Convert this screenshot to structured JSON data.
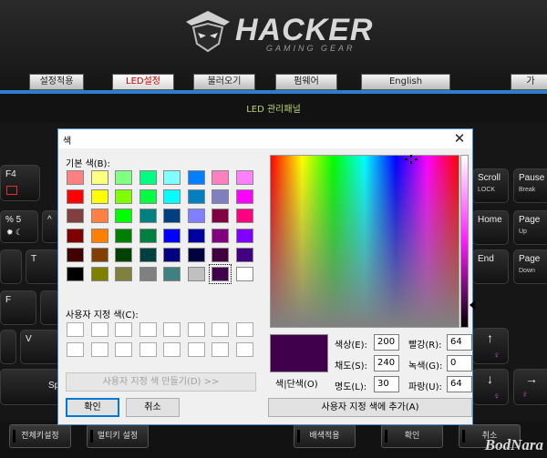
{
  "app": {
    "brand": "HACKER",
    "brand_sub": "GAMING GEAR",
    "nav_tabs": [
      {
        "label": "설정적용"
      },
      {
        "label": "LED설정"
      },
      {
        "label": "불러오기"
      },
      {
        "label": "펌웨어"
      },
      {
        "label": "English"
      },
      {
        "label": "가"
      }
    ],
    "sub_title": "LED 관리패널",
    "bottom_buttons": [
      "전체키설정",
      "멀티키 설정",
      "배색적용",
      "확인",
      "취소"
    ],
    "watermark": "BodNara"
  },
  "keyboard": {
    "keys": [
      {
        "main": "F4",
        "sub": ""
      },
      {
        "main": "% 5",
        "sub": ""
      },
      {
        "main": "^",
        "sub": ""
      },
      {
        "main": "T",
        "sub": ""
      },
      {
        "main": "F",
        "sub": ""
      },
      {
        "main": "V",
        "sub": ""
      },
      {
        "main": "Sp",
        "sub": ""
      },
      {
        "main": "Scroll",
        "sub": "LOCK"
      },
      {
        "main": "Pause",
        "sub": "Break"
      },
      {
        "main": "Home",
        "sub": ""
      },
      {
        "main": "Page",
        "sub": "Up"
      },
      {
        "main": "End",
        "sub": ""
      },
      {
        "main": "Page",
        "sub": "Down"
      },
      {
        "main": "↑",
        "sub": ""
      },
      {
        "main": "↓",
        "sub": ""
      },
      {
        "main": "→",
        "sub": ""
      }
    ]
  },
  "dialog": {
    "title": "색",
    "basic_colors_label": "기본 색(B):",
    "basic_colors": [
      "#ff8080",
      "#ffff80",
      "#80ff80",
      "#00ff80",
      "#80ffff",
      "#0080ff",
      "#ff80c0",
      "#ff80ff",
      "#ff0000",
      "#ffff00",
      "#80ff00",
      "#00ff40",
      "#00ffff",
      "#0080c0",
      "#8080c0",
      "#ff00ff",
      "#804040",
      "#ff8040",
      "#00ff00",
      "#008080",
      "#004080",
      "#8080ff",
      "#800040",
      "#ff0080",
      "#800000",
      "#ff8000",
      "#008000",
      "#008040",
      "#0000ff",
      "#0000a0",
      "#800080",
      "#8000ff",
      "#400000",
      "#804000",
      "#004000",
      "#004040",
      "#000080",
      "#000040",
      "#400040",
      "#400080",
      "#000000",
      "#808000",
      "#808040",
      "#808080",
      "#408080",
      "#c0c0c0",
      "#40004b",
      "#ffffff"
    ],
    "selected_basic_index": 46,
    "custom_colors_label": "사용자 지정 색(C):",
    "custom_colors": [
      "#ffffff",
      "#ffffff",
      "#ffffff",
      "#ffffff",
      "#ffffff",
      "#ffffff",
      "#ffffff",
      "#ffffff",
      "#ffffff",
      "#ffffff",
      "#ffffff",
      "#ffffff",
      "#ffffff",
      "#ffffff",
      "#ffffff",
      "#ffffff"
    ],
    "define_custom_button": "사용자 지정 색 만들기(D) >>",
    "ok_button": "확인",
    "cancel_button": "취소",
    "preview_label": "색|단색(O)",
    "preview_color": "#40004b",
    "fields": {
      "hue_label": "색상(E):",
      "hue": "200",
      "sat_label": "채도(S):",
      "sat": "240",
      "lum_label": "명도(L):",
      "lum": "30",
      "red_label": "빨강(R):",
      "red": "64",
      "green_label": "녹색(G):",
      "green": "0",
      "blue_label": "파랑(U):",
      "blue": "64"
    },
    "add_custom_button": "사용자 지정 색에 추가(A)"
  }
}
